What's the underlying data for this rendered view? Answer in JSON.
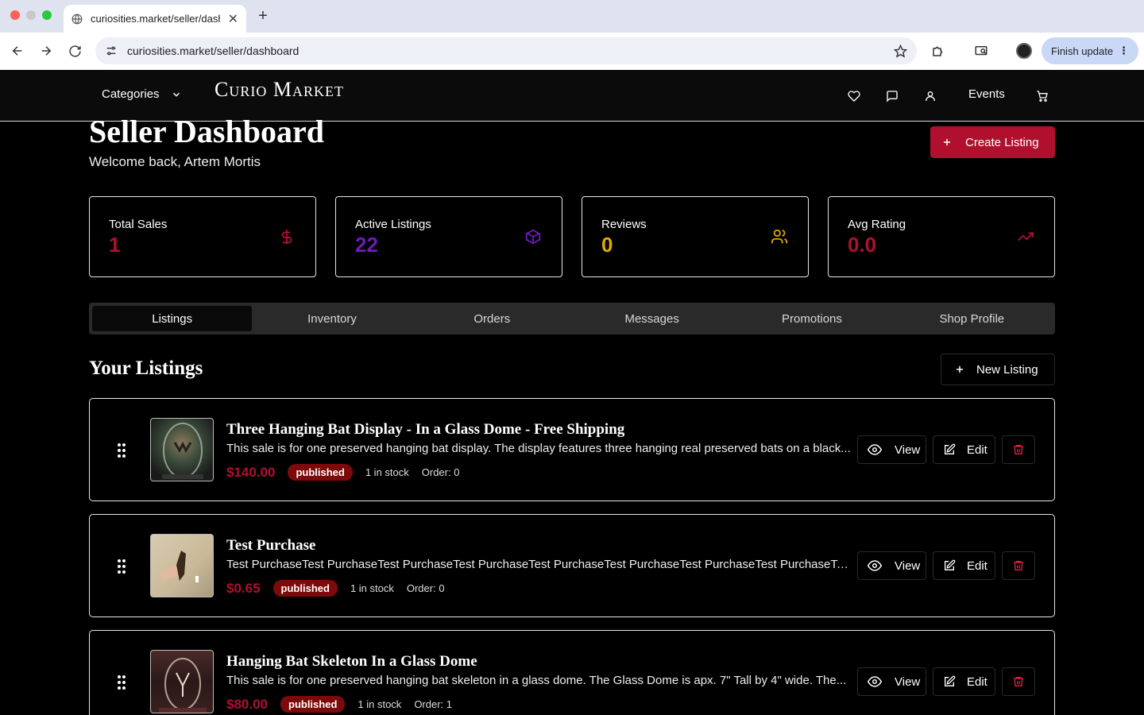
{
  "browser": {
    "tab_title": "curiosities.market/seller/dash",
    "url": "curiosities.market/seller/dashboard",
    "finish_update_label": "Finish update"
  },
  "header": {
    "categories_label": "Categories",
    "logo_text": "Curio Market",
    "events_label": "Events"
  },
  "page": {
    "title": "Seller Dashboard",
    "welcome": "Welcome back, Artem Mortis",
    "create_listing_label": "Create Listing"
  },
  "stats": [
    {
      "label": "Total Sales",
      "value": "1",
      "color": "#b0102e",
      "icon": "dollar-icon"
    },
    {
      "label": "Active Listings",
      "value": "22",
      "color": "#6d1ab8",
      "icon": "package-icon"
    },
    {
      "label": "Reviews",
      "value": "0",
      "color": "#e0a800",
      "icon": "users-icon"
    },
    {
      "label": "Avg Rating",
      "value": "0.0",
      "color": "#b0102e",
      "icon": "trending-up-icon"
    }
  ],
  "tabs": [
    "Listings",
    "Inventory",
    "Orders",
    "Messages",
    "Promotions",
    "Shop Profile"
  ],
  "listings_section": {
    "title": "Your Listings",
    "new_listing_label": "New Listing"
  },
  "listings": [
    {
      "title": "Three Hanging Bat Display - In a Glass Dome - Free Shipping",
      "description": "This sale is for one preserved hanging bat display. The display features  three hanging real preserved bats on a black...",
      "price": "$140.00",
      "status": "published",
      "stock": "1 in stock",
      "order": "Order: 0"
    },
    {
      "title": "Test Purchase",
      "description": "Test PurchaseTest PurchaseTest PurchaseTest PurchaseTest PurchaseTest PurchaseTest PurchaseTest PurchaseTest...",
      "price": "$0.65",
      "status": "published",
      "stock": "1 in stock",
      "order": "Order: 0"
    },
    {
      "title": "Hanging Bat Skeleton In a Glass Dome",
      "description": "This sale is for one preserved hanging bat skeleton in a glass dome. The Glass Dome is apx. 7\" Tall by 4\" wide. The...",
      "price": "$80.00",
      "status": "published",
      "stock": "1 in stock",
      "order": "Order: 1"
    }
  ],
  "actions": {
    "view_label": "View",
    "edit_label": "Edit"
  }
}
